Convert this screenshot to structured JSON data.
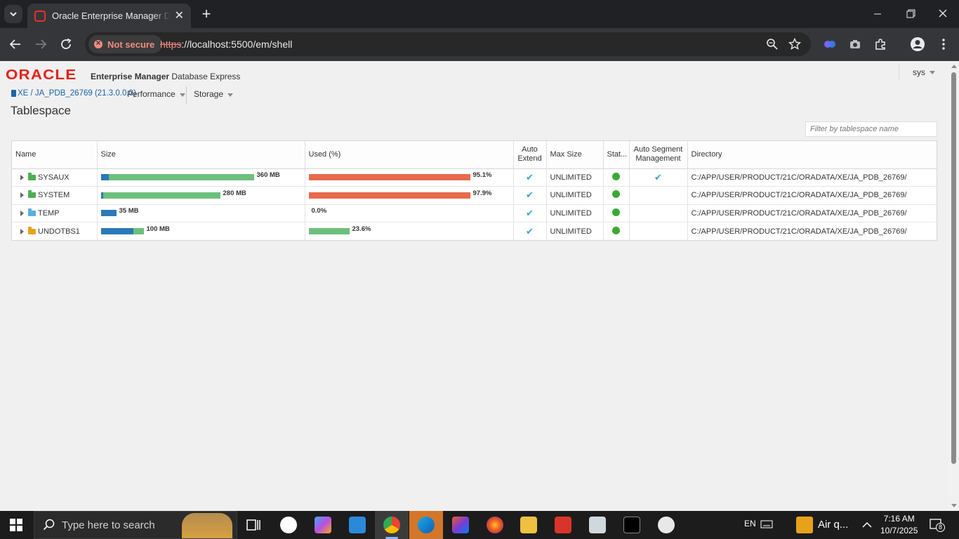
{
  "browser": {
    "tab_title": "Oracle Enterprise Manager Database Express",
    "security_label": "Not secure",
    "url_protocol": "https",
    "url_rest": "://localhost:5500/em/shell"
  },
  "header": {
    "logo_text": "ORACLE",
    "product_bold": "Enterprise Manager",
    "product_rest": " Database Express",
    "user": "sys"
  },
  "nav": {
    "db_link": "XE / JA_PDB_26769 (21.3.0.0.0)",
    "menu_performance": "Performance",
    "menu_storage": "Storage"
  },
  "page": {
    "title": "Tablespace",
    "filter_placeholder": "Filter by tablespace name"
  },
  "table": {
    "columns": {
      "name": "Name",
      "size": "Size",
      "used": "Used (%)",
      "auto_extend": "Auto Extend",
      "max_size": "Max Size",
      "status": "Stat...",
      "asm": "Auto Segment Management",
      "directory": "Directory"
    },
    "rows": [
      {
        "name": "SYSAUX",
        "type": "permanent",
        "size_label": "360 MB",
        "size_bar": 1.0,
        "size_used_fraction": 0.05,
        "used_label": "95.1%",
        "used_value": 95.1,
        "used_bar": 1.0,
        "used_color": "#e86a4c",
        "auto_extend": true,
        "max_size": "UNLIMITED",
        "status": "online",
        "auto_segment": true,
        "directory": "C:/APP/USER/PRODUCT/21C/ORADATA/XE/JA_PDB_26769/"
      },
      {
        "name": "SYSTEM",
        "type": "permanent",
        "size_label": "280 MB",
        "size_bar": 0.78,
        "size_used_fraction": 0.02,
        "used_label": "97.9%",
        "used_value": 97.9,
        "used_bar": 1.0,
        "used_color": "#e86a4c",
        "auto_extend": true,
        "max_size": "UNLIMITED",
        "status": "online",
        "auto_segment": false,
        "directory": "C:/APP/USER/PRODUCT/21C/ORADATA/XE/JA_PDB_26769/"
      },
      {
        "name": "TEMP",
        "type": "temporary",
        "size_label": "35 MB",
        "size_bar": 0.1,
        "size_used_fraction": 1.0,
        "used_label": "0.0%",
        "used_value": 0.0,
        "used_bar": 0.0,
        "used_color": "#6cc07c",
        "auto_extend": true,
        "max_size": "UNLIMITED",
        "status": "online",
        "auto_segment": false,
        "directory": "C:/APP/USER/PRODUCT/21C/ORADATA/XE/JA_PDB_26769/"
      },
      {
        "name": "UNDOTBS1",
        "type": "undo",
        "size_label": "100 MB",
        "size_bar": 0.28,
        "size_used_fraction": 0.76,
        "used_label": "23.6%",
        "used_value": 23.6,
        "used_bar": 0.25,
        "used_color": "#6cc07c",
        "auto_extend": true,
        "max_size": "UNLIMITED",
        "status": "online",
        "auto_segment": false,
        "directory": "C:/APP/USER/PRODUCT/21C/ORADATA/XE/JA_PDB_26769/"
      }
    ]
  },
  "colors": {
    "size_used": "#2a7ab8",
    "size_free": "#6cc07c",
    "check": "#3aa0d8",
    "status_online": "#3aaa35"
  },
  "taskbar": {
    "search_placeholder": "Type here to search",
    "language": "EN",
    "weather": "Air q...",
    "time": "7:16 AM",
    "date": "10/7/2025",
    "notification_count": "8"
  }
}
